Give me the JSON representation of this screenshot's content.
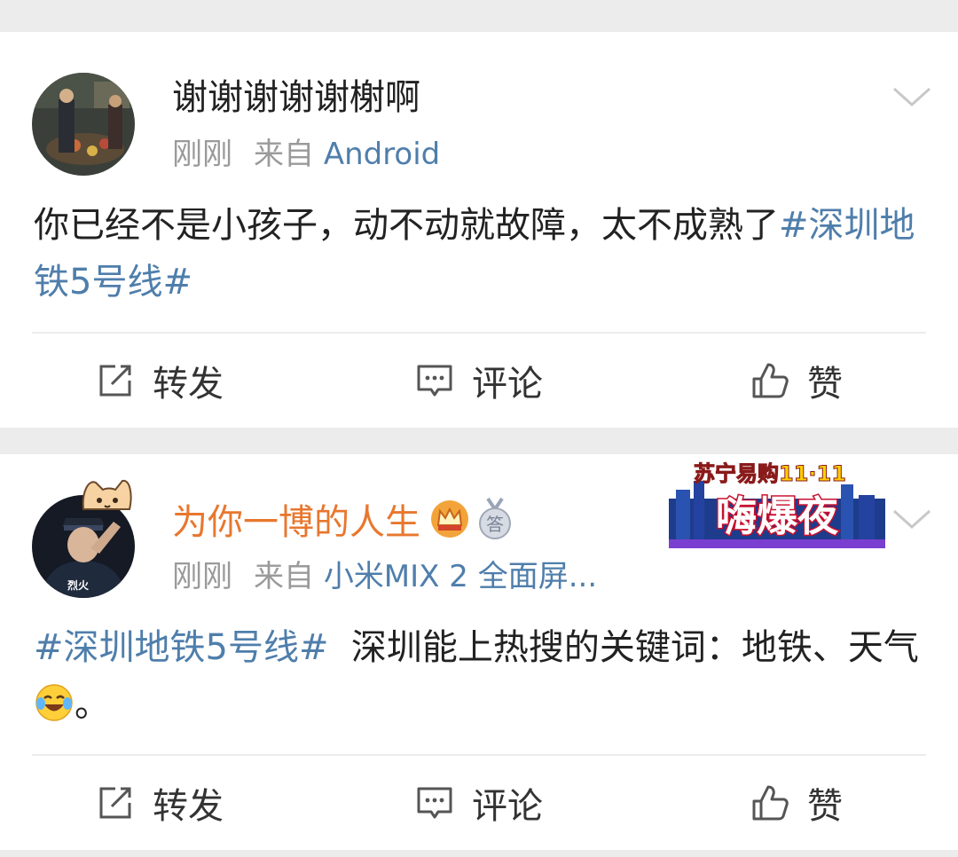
{
  "posts": [
    {
      "username": "谢谢谢谢谢榭啊",
      "time": "刚刚",
      "source_label": "来自",
      "source": "Android",
      "content_text": "你已经不是小孩子，动不动就故障，太不成熟了",
      "hashtag": "#深圳地铁5号线#",
      "actions": {
        "repost": "转发",
        "comment": "评论",
        "like": "赞"
      }
    },
    {
      "username": "为你一博的人生",
      "time": "刚刚",
      "source_label": "来自",
      "source": "小米MIX 2 全面屏...",
      "hashtag": "#深圳地铁5号线#",
      "content_text": "深圳能上热搜的关键词：地铁、天气",
      "content_end": "。",
      "avatar_caption": "烈火",
      "medal_char": "答",
      "promo": {
        "line1": "苏宁易购11·11",
        "line2": "嗨爆夜"
      },
      "actions": {
        "repost": "转发",
        "comment": "评论",
        "like": "赞"
      }
    }
  ],
  "colors": {
    "link": "#4f7eab",
    "username_orange": "#e8772e",
    "meta_gray": "#9a9a9a"
  },
  "icons": [
    "chevron-down-icon",
    "repost-icon",
    "comment-icon",
    "like-icon",
    "vip-crown-icon",
    "medal-icon",
    "laugh-cry-emoji"
  ]
}
